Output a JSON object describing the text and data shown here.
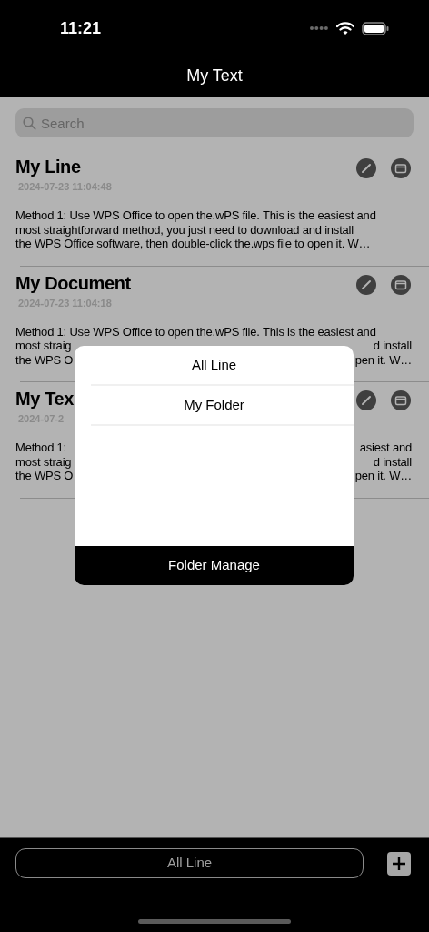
{
  "status_bar": {
    "time": "11:21"
  },
  "nav": {
    "title": "My Text"
  },
  "search": {
    "placeholder": "Search"
  },
  "cards": [
    {
      "title": "My Line",
      "date": "2024-07-23 11:04:48",
      "lines": [
        {
          "left": "Method 1: Use WPS Office to open the.wPS file. This is the easiest and"
        },
        {
          "left": "most straightforward method, you just need to download and install"
        },
        {
          "left": "the WPS Office software, then double-click the.wps file to open it. W…"
        }
      ]
    },
    {
      "title": "My Document",
      "date": "2024-07-23 11:04:18",
      "lines": [
        {
          "left": "Method 1: Use WPS Office to open the.wPS file. This is the easiest and"
        },
        {
          "left": "most straig",
          "right": "d install"
        },
        {
          "left": "the WPS O",
          "right": "pen it. W…"
        }
      ]
    },
    {
      "title": "My Tex",
      "date": "2024-07-2",
      "lines": [
        {
          "left": "Method 1:",
          "right": "asiest and"
        },
        {
          "left": "most straig",
          "right": "d install"
        },
        {
          "left": "the WPS O",
          "right": "pen it. W…"
        }
      ]
    }
  ],
  "popup": {
    "items": [
      "All Line",
      "My Folder"
    ],
    "footer_button": "Folder Manage"
  },
  "bottom_bar": {
    "folder_button": "All Line"
  }
}
